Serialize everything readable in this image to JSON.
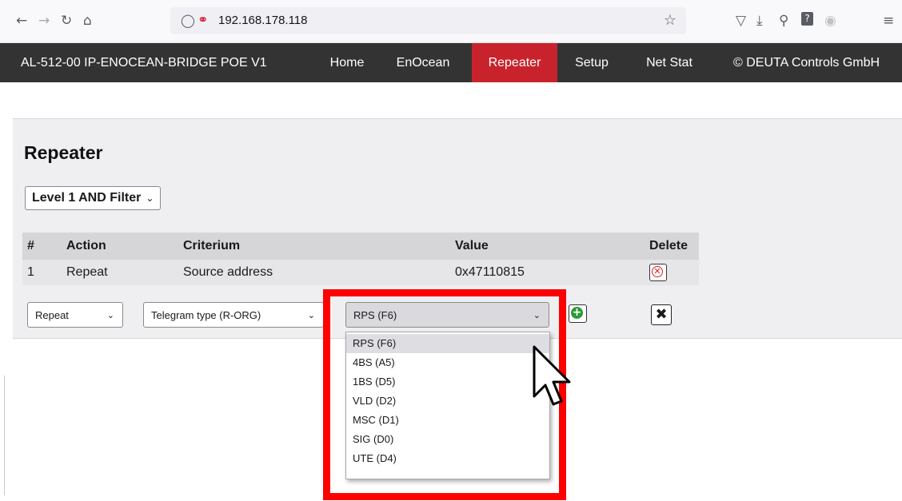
{
  "browser": {
    "url": "192.168.178.118",
    "icons": [
      "back-icon",
      "forward-icon",
      "reload-icon",
      "home-icon",
      "shield-icon",
      "lock-icon",
      "star-icon",
      "pocket-icon",
      "download-icon",
      "extension-icon",
      "help-icon",
      "account-icon",
      "menu-icon"
    ]
  },
  "nav": {
    "brand": "AL-512-00 IP-ENOCEAN-BRIDGE POE V1",
    "items": [
      "Home",
      "EnOcean",
      "Repeater",
      "Setup",
      "Net Stat"
    ],
    "active": "Repeater",
    "copyright": "© DEUTA Controls GmbH",
    "active_color": "#c8232c"
  },
  "page": {
    "title": "Repeater",
    "level_select": "Level 1 AND Filter"
  },
  "table": {
    "headers": [
      "#",
      "Action",
      "Criterium",
      "Value",
      "Delete"
    ],
    "rows": [
      {
        "num": "1",
        "action": "Repeat",
        "criterium": "Source address",
        "value": "0x47110815"
      }
    ]
  },
  "form": {
    "action_select": "Repeat",
    "criterium_select": "Telegram type (R-ORG)",
    "value_select": "RPS (F6)",
    "value_options": [
      "RPS (F6)",
      "4BS (A5)",
      "1BS (D5)",
      "VLD (D2)",
      "MSC (D1)",
      "SIG (D0)",
      "UTE (D4)"
    ],
    "highlighted_option": "RPS (F6)"
  },
  "highlight_color": "#ff0000"
}
